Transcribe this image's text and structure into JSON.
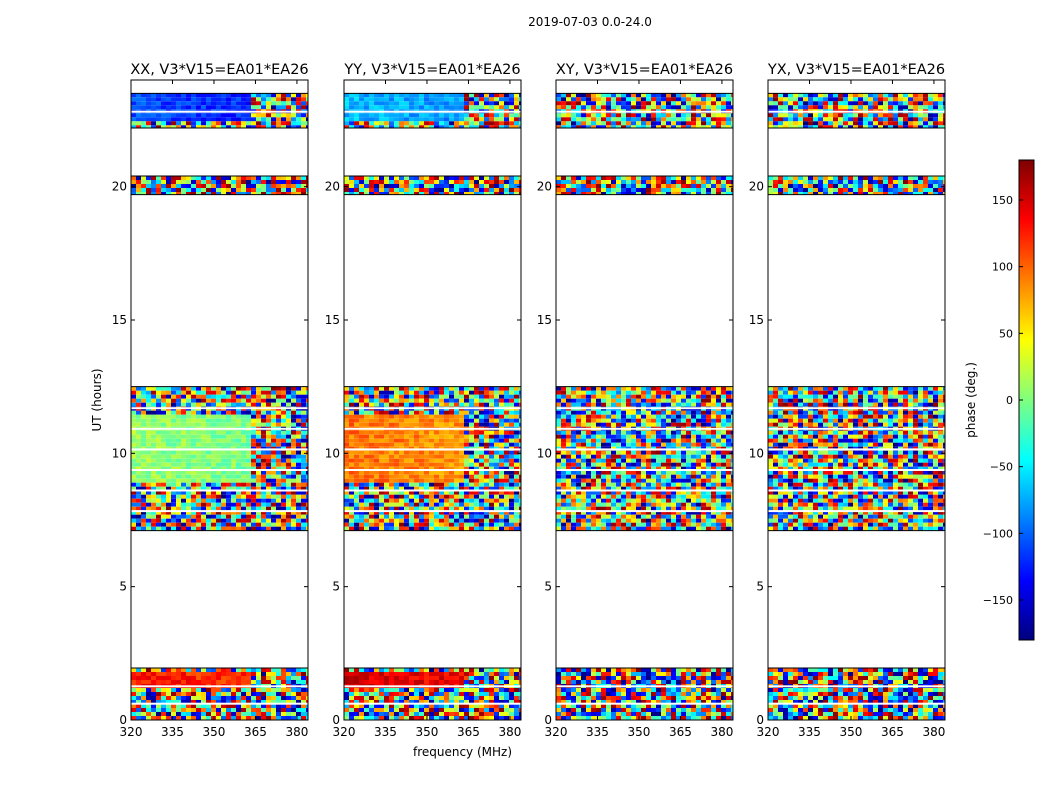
{
  "figure": {
    "suptitle": "2019-07-03 0.0-24.0"
  },
  "colorbar": {
    "label": "phase (deg.)",
    "range": [
      -180,
      180
    ],
    "ticks": [
      150,
      100,
      50,
      0,
      -50,
      -100,
      -150
    ],
    "tick_labels": [
      "150",
      "100",
      "50",
      "0",
      "−50",
      "−100",
      "−150"
    ],
    "colormap": [
      "#00007f",
      "#0000ff",
      "#007fff",
      "#00ffff",
      "#7fff7f",
      "#ffff00",
      "#ff7f00",
      "#ff0000",
      "#7f0000"
    ]
  },
  "chart_data": [
    {
      "type": "heatmap",
      "title": "XX, V3*V15=EA01*EA26",
      "xlabel": "",
      "ylabel": "UT (hours)",
      "xlim": [
        320,
        384
      ],
      "ylim": [
        0,
        24
      ],
      "xticks": [
        320,
        335,
        350,
        365,
        380
      ],
      "yticks": [
        0,
        5,
        10,
        15,
        20
      ],
      "time_ranges": [
        [
          0,
          1.95
        ],
        [
          7.1,
          12.5
        ],
        [
          19.7,
          20.4
        ],
        [
          22.2,
          23.5
        ]
      ],
      "smooth_phase": [
        {
          "t": [
            1.3,
            1.9
          ],
          "phase": 130
        },
        {
          "t": [
            9.0,
            11.5
          ],
          "phase": 10
        },
        {
          "t": [
            22.5,
            23.5
          ],
          "phase": -110
        }
      ]
    },
    {
      "type": "heatmap",
      "title": "YY, V3*V15=EA01*EA26",
      "xlabel": "frequency (MHz)",
      "ylabel": "",
      "xlim": [
        320,
        384
      ],
      "ylim": [
        0,
        24
      ],
      "xticks": [
        320,
        335,
        350,
        365,
        380
      ],
      "yticks": [
        0,
        5,
        10,
        15,
        20
      ],
      "time_ranges": [
        [
          0,
          1.95
        ],
        [
          7.1,
          12.5
        ],
        [
          19.7,
          20.4
        ],
        [
          22.2,
          23.5
        ]
      ],
      "smooth_phase": [
        {
          "t": [
            1.3,
            1.9
          ],
          "phase": 150
        },
        {
          "t": [
            9.0,
            11.5
          ],
          "phase": 95
        },
        {
          "t": [
            22.5,
            23.5
          ],
          "phase": -70
        }
      ]
    },
    {
      "type": "heatmap",
      "title": "XY, V3*V15=EA01*EA26",
      "xlabel": "",
      "ylabel": "",
      "xlim": [
        320,
        384
      ],
      "ylim": [
        0,
        24
      ],
      "xticks": [
        320,
        335,
        350,
        365,
        380
      ],
      "yticks": [
        0,
        5,
        10,
        15,
        20
      ],
      "time_ranges": [
        [
          0,
          1.95
        ],
        [
          7.1,
          12.5
        ],
        [
          19.7,
          20.4
        ],
        [
          22.2,
          23.5
        ]
      ],
      "smooth_phase": []
    },
    {
      "type": "heatmap",
      "title": "YX, V3*V15=EA01*EA26",
      "xlabel": "",
      "ylabel": "",
      "xlim": [
        320,
        384
      ],
      "ylim": [
        0,
        24
      ],
      "xticks": [
        320,
        335,
        350,
        365,
        380
      ],
      "yticks": [
        0,
        5,
        10,
        15,
        20
      ],
      "time_ranges": [
        [
          0,
          1.95
        ],
        [
          7.1,
          12.5
        ],
        [
          19.7,
          20.4
        ],
        [
          22.2,
          23.5
        ]
      ],
      "smooth_phase": []
    }
  ]
}
